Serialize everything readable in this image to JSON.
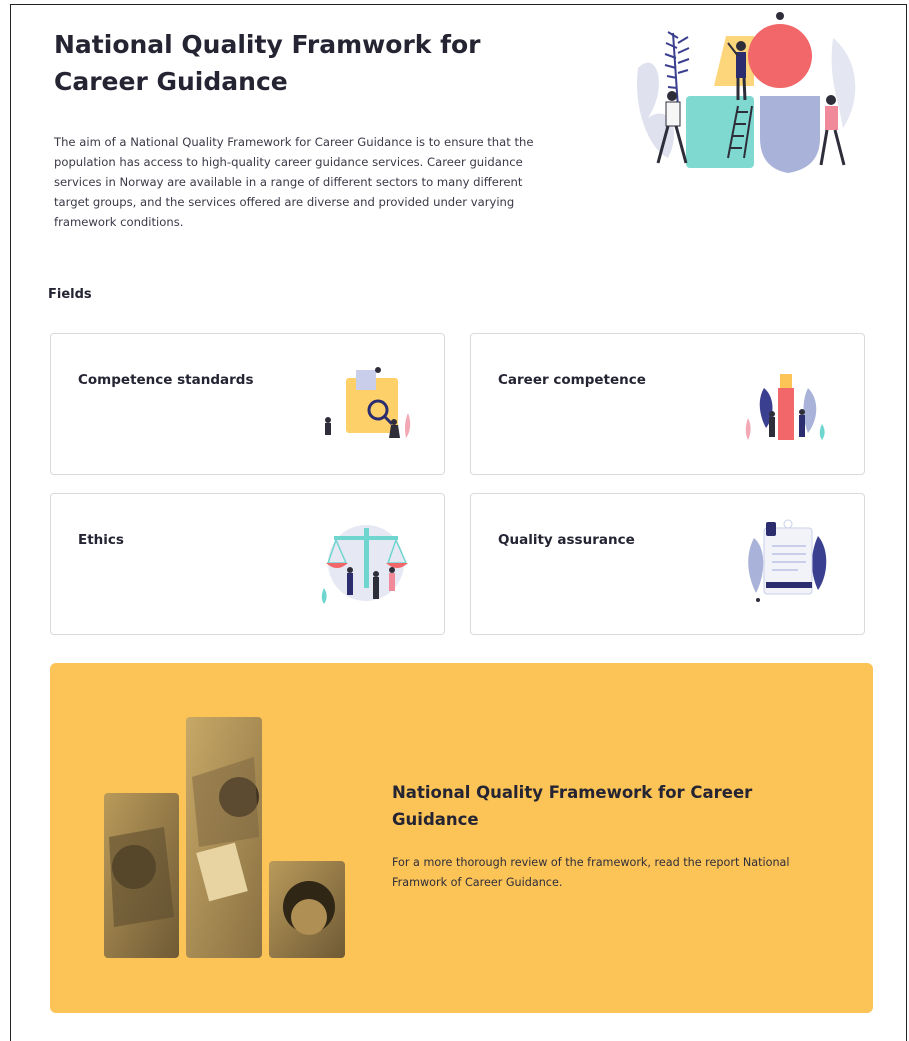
{
  "hero": {
    "title": "National Quality Framwork for Career Guidance",
    "description": "The aim of a National Quality Framework for Career Guidance is to ensure that the population has access to high-quality career guidance services. Career guidance services in Norway are available in a range of different sectors to many different target groups, and the services offered are diverse and provided under varying framework conditions."
  },
  "fields": {
    "heading": "Fields",
    "cards": [
      {
        "label": "Competence standards",
        "icon": "competence-standards-illustration"
      },
      {
        "label": "Career competence",
        "icon": "career-competence-illustration"
      },
      {
        "label": "Ethics",
        "icon": "ethics-scale-illustration"
      },
      {
        "label": "Quality assurance",
        "icon": "quality-assurance-document-illustration"
      }
    ]
  },
  "banner": {
    "title": "National Quality Framework for Career Guidance",
    "text": "For a more thorough review of the framework, read the report National Framwork of Career Guidance.",
    "background": "#fcc357"
  },
  "colors": {
    "text": "#242433",
    "card_border": "#d9d9de",
    "accent_red": "#f05a5e",
    "accent_teal": "#6fd6cf",
    "accent_navy": "#2b2d6e"
  }
}
